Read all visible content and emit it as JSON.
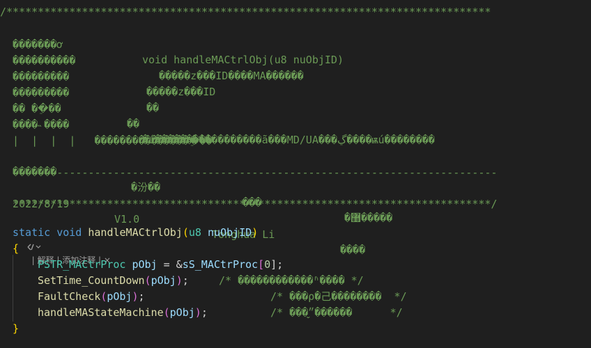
{
  "comment": {
    "border_top": "/*****************************************************************************",
    "rows": [
      {
        "left": "  �������ơ",
        "right": "void handleMACtrlObj(u8 nuObjID)"
      },
      {
        "left": "  ����������",
        "right": "�����z���ID����MA������"
      },
      {
        "left": "  ���������",
        "right": "�����z���ID"
      },
      {
        "left": "  ���������",
        "right": "��"
      },
      {
        "left": "  �� ��ֵ��",
        "right": "��"
      },
      {
        "left": "  ����˵����",
        "right": "�ú�����������������ã���MD/UA���ڲ����ѭú��������"
      }
    ],
    "continuation": "  |  |  |  |   ����������������ֵ��",
    "history_header": [
      "  �������",
      "�汾��",
      "���",
      "�޸�����"
    ],
    "divider": "  -----------------------------------------------------------------------------",
    "history_row": [
      "  2022/8/19",
      "V1.0",
      "Tonghua Li",
      "����"
    ],
    "border_bottom": "  ****************************************************************************/"
  },
  "codelens": {
    "icon": "sparkle-code-icon",
    "items": [
      "| 解释 |",
      "添加注释",
      "| ×"
    ]
  },
  "code": {
    "signature": {
      "kw1": "static",
      "kw2": "void",
      "name": "handleMACtrlObj",
      "type": "u8",
      "param": "nuObjID"
    },
    "open_brace": "{",
    "close_brace": "}",
    "stmt1": {
      "type": "PSTR_MACtrProc",
      "var": "pObj",
      "eq": "= &",
      "arr": "sS_MACtrProc",
      "idx": "0",
      "end": "];"
    },
    "stmt2": {
      "fn": "SetTime_CountDown",
      "arg": "pObj",
      "comment": "/* ������������ʱ���� */"
    },
    "stmt3": {
      "fn": "FaultCheck",
      "arg": "pObj",
      "comment": "/* ���ρ�己��������  */"
    },
    "stmt4": {
      "fn": "handleMAStateMachine",
      "arg": "pObj",
      "comment": "/* ���״̬������      */"
    }
  }
}
